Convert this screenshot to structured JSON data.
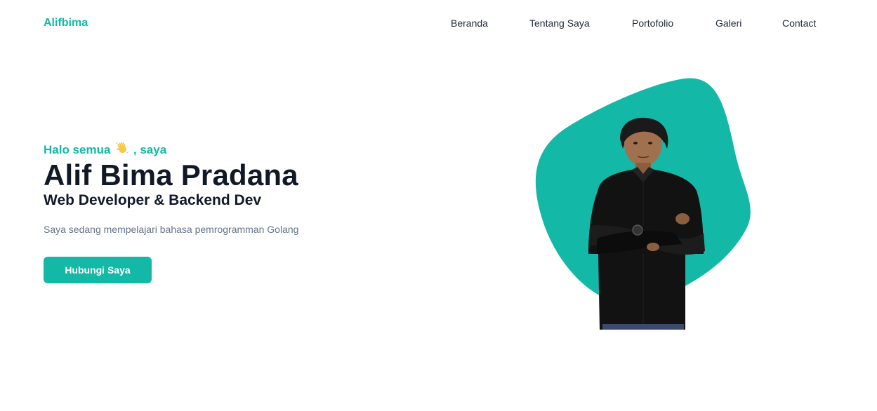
{
  "header": {
    "brand": "Alifbima",
    "nav": [
      {
        "label": "Beranda"
      },
      {
        "label": "Tentang Saya"
      },
      {
        "label": "Portofolio"
      },
      {
        "label": "Galeri"
      },
      {
        "label": "Contact"
      }
    ]
  },
  "hero": {
    "greeting_before": "Halo semua",
    "greeting_after": ", saya",
    "greeting_icon": "waving-hand-icon",
    "name": "Alif Bima Pradana",
    "role": "Web Developer & Backend Dev",
    "description": "Saya sedang mempelajari bahasa pemrogramman Golang",
    "cta_label": "Hubungi Saya"
  },
  "colors": {
    "accent": "#14b8a6",
    "heading": "#111827",
    "muted": "#64748b",
    "background": "#ffffff"
  }
}
